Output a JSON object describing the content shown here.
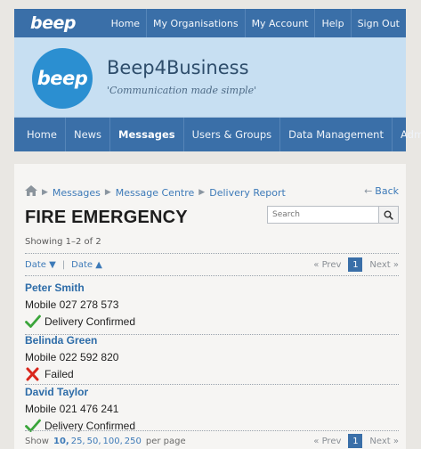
{
  "topbar": {
    "logo": "beep",
    "nav": [
      "Home",
      "My Organisations",
      "My Account",
      "Help",
      "Sign Out"
    ]
  },
  "banner": {
    "logo": "beep",
    "title": "Beep4Business",
    "tagline": "'Communication made simple'"
  },
  "mainnav": {
    "items": [
      "Home",
      "News",
      "Messages",
      "Users & Groups",
      "Data Management",
      "Admin"
    ],
    "active": "Messages"
  },
  "breadcrumb": {
    "home_icon": "home-icon",
    "items": [
      "Messages",
      "Message Centre",
      "Delivery Report"
    ]
  },
  "back_label": "Back",
  "page_title": "FIRE EMERGENCY",
  "search": {
    "placeholder": "Search",
    "icon": "search-icon"
  },
  "showing": "Showing 1–2 of 2",
  "sort": {
    "first": "Date ▼",
    "second": "Date ▲"
  },
  "pager": {
    "prev": "« Prev",
    "current": "1",
    "next": "Next »"
  },
  "messages": [
    {
      "name": "Peter Smith",
      "mobile": "Mobile 027 278 573",
      "status": "Delivery Confirmed",
      "status_icon": "check-icon"
    },
    {
      "name": "Belinda Green",
      "mobile": "Mobile 022 592 820",
      "status": "Failed",
      "status_icon": "cross-icon"
    },
    {
      "name": "David Taylor",
      "mobile": "Mobile 021 476 241",
      "status": "Delivery Confirmed",
      "status_icon": "check-icon"
    }
  ],
  "footer": {
    "show_label": "Show",
    "perpage_options": [
      "10,",
      "25,",
      "50,",
      "100,",
      "250"
    ],
    "perpage_current": "10,",
    "perpage_suffix": "per page"
  },
  "colors": {
    "nav_blue": "#3a6fa8",
    "link_blue": "#3d7ab8",
    "banner_bg": "#c7dff2",
    "check_green": "#3aa53a",
    "cross_red": "#d9261c"
  }
}
